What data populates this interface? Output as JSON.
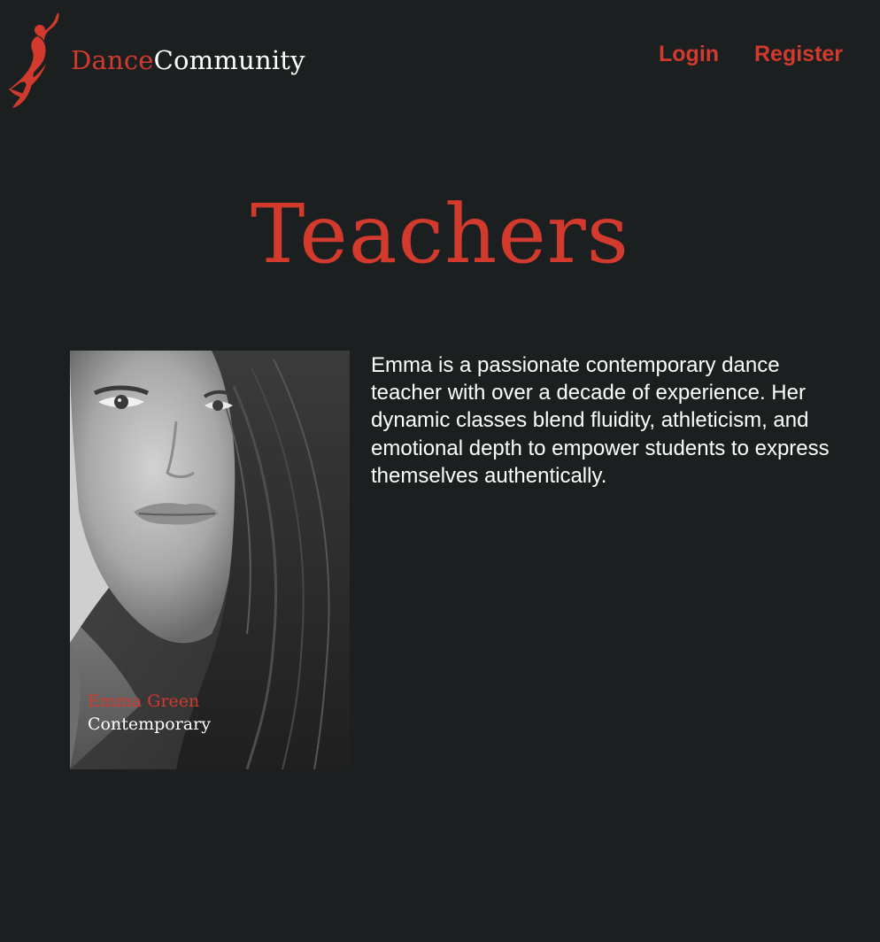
{
  "header": {
    "brand_part1": "Dance",
    "brand_part2": "Community",
    "logo_icon": "dancer-logo-icon",
    "nav": {
      "login": "Login",
      "register": "Register"
    }
  },
  "main": {
    "title": "Teachers",
    "teacher": {
      "name": "Emma Green",
      "style": "Contemporary",
      "photo_icon": "teacher-portrait-photo",
      "bio": "Emma is a passionate contemporary dance teacher with over a decade of experience. Her dynamic classes blend fluidity, athleticism, and emotional depth to empower students to express themselves authentically."
    }
  },
  "colors": {
    "background": "#1c1f20",
    "accent": "#d23a2d",
    "text": "#ffffff"
  }
}
